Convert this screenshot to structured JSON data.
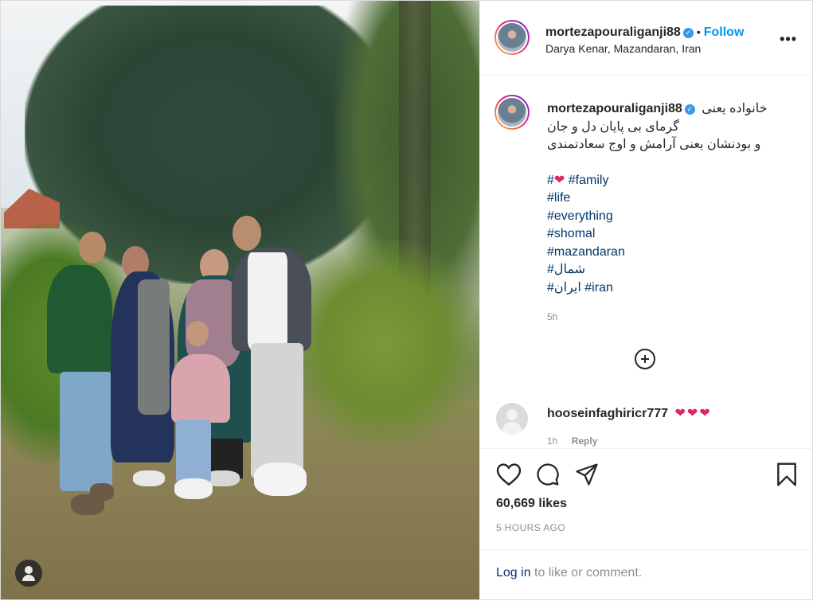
{
  "post": {
    "username": "mortezapouraliganji88",
    "verified_glyph": "✓",
    "separator": "•",
    "follow_label": "Follow",
    "location": "Darya Kenar, Mazandaran, Iran",
    "more_label": "•••"
  },
  "caption": {
    "username": "mortezapouraliganji88",
    "line1": "خانواده یعنی",
    "line2": "گرمای بی پایان دل و جان",
    "line3": "و بودنشان یعنی آرامش و اوج سعادتمندی",
    "hashtags": [
      {
        "a": "#",
        "heart": "❤",
        "b": "#family"
      },
      {
        "a": "#life"
      },
      {
        "a": "#everything"
      },
      {
        "a": "#shomal"
      },
      {
        "a": "#mazandaran"
      },
      {
        "a": "#شمال"
      },
      {
        "a": "#ایران",
        "b": "#iran"
      }
    ],
    "time": "5h"
  },
  "comment": {
    "username": "hooseinfaghiricr777",
    "text": "❤❤❤",
    "time": "1h",
    "reply_label": "Reply"
  },
  "actions": {
    "likes": "60,669 likes",
    "post_time": "5 HOURS AGO",
    "login_link": "Log in",
    "login_rest": "to like or comment."
  },
  "colors": {
    "link_blue": "#0095f6",
    "hashtag": "#00376b",
    "verified": "#3897f0",
    "heart": "#e0245e"
  },
  "icons": [
    "heart-icon",
    "comment-icon",
    "share-icon",
    "bookmark-icon",
    "more-options-icon",
    "load-more-comments-icon",
    "verified-badge-icon",
    "user-tag-icon"
  ]
}
